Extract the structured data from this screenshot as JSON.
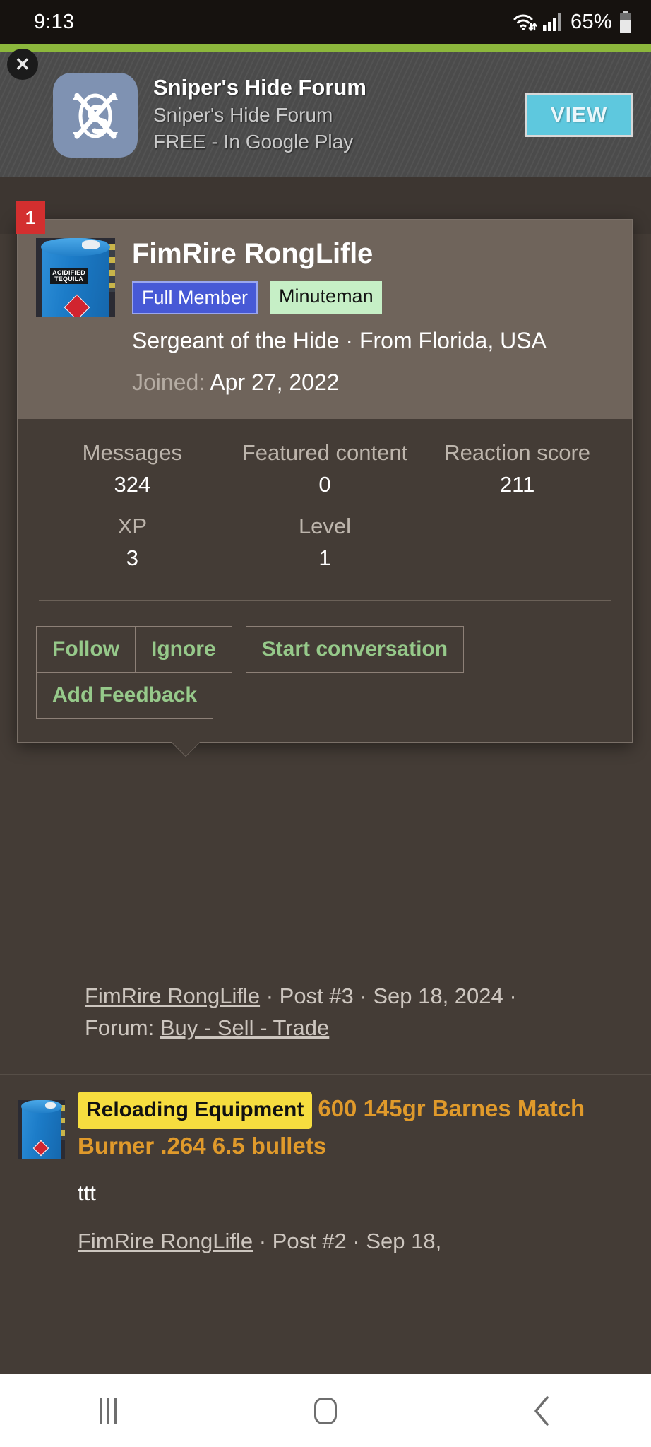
{
  "statusbar": {
    "time": "9:13",
    "battery_percent": "65%",
    "icons": [
      "wifi-updown-icon",
      "signal-bars-icon",
      "battery-icon"
    ]
  },
  "ad": {
    "close_icon": "✕",
    "app_icon": "snipers-hide-logo-icon",
    "title": "Sniper's Hide Forum",
    "subtitle": "Sniper's Hide Forum",
    "price_line": "FREE - In Google Play",
    "cta_label": "VIEW",
    "accent_color": "#8cb73c",
    "cta_color": "#5ec8de"
  },
  "unread_badge": "1",
  "profile_card": {
    "avatar_name": "acidified-tequila-barrel-avatar",
    "avatar_label_line1": "ACIDIFIED",
    "avatar_label_line2": "TEQUILA",
    "username": "FimRire RongLifle",
    "badges": [
      {
        "label": "Full Member",
        "bg": "#4759d6",
        "fg": "#ffffff"
      },
      {
        "label": "Minuteman",
        "bg": "#c6efc6",
        "fg": "#111111"
      }
    ],
    "user_title": "Sergeant of the Hide · From Florida, USA",
    "joined_label": "Joined:",
    "joined_value": "Apr 27, 2022",
    "stats": [
      {
        "label": "Messages",
        "value": "324"
      },
      {
        "label": "Featured content",
        "value": "0"
      },
      {
        "label": "Reaction score",
        "value": "211"
      },
      {
        "label": "XP",
        "value": "3"
      },
      {
        "label": "Level",
        "value": "1"
      }
    ],
    "actions": [
      "Follow",
      "Ignore",
      "Start conversation",
      "Add Feedback"
    ],
    "action_color": "#96c98a"
  },
  "post_meta_top": {
    "author": "FimRire RongLifle",
    "sep1": " · ",
    "post_number": "Post #3",
    "sep2": " · ",
    "date": "Sep 18, 2024",
    "sep3": " · ",
    "forum_label": "Forum: ",
    "forum": "Buy - Sell - Trade"
  },
  "post_item": {
    "thumb_name": "acidified-tequila-barrel-thumbnail",
    "prefix": "Reloading Equipment",
    "title": "600 145gr Barnes Match Burner .264 6.5 bullets",
    "snippet": "ttt",
    "meta_author": "FimRire RongLifle",
    "meta_sep1": " · ",
    "meta_post_number": "Post #2",
    "meta_sep2": " · ",
    "meta_date": "Sep 18,",
    "prefix_bg": "#f6dd3f",
    "title_color": "#e09a2b"
  },
  "navbar": {
    "recents_label": "recent-apps",
    "home_label": "home",
    "back_label": "back"
  }
}
